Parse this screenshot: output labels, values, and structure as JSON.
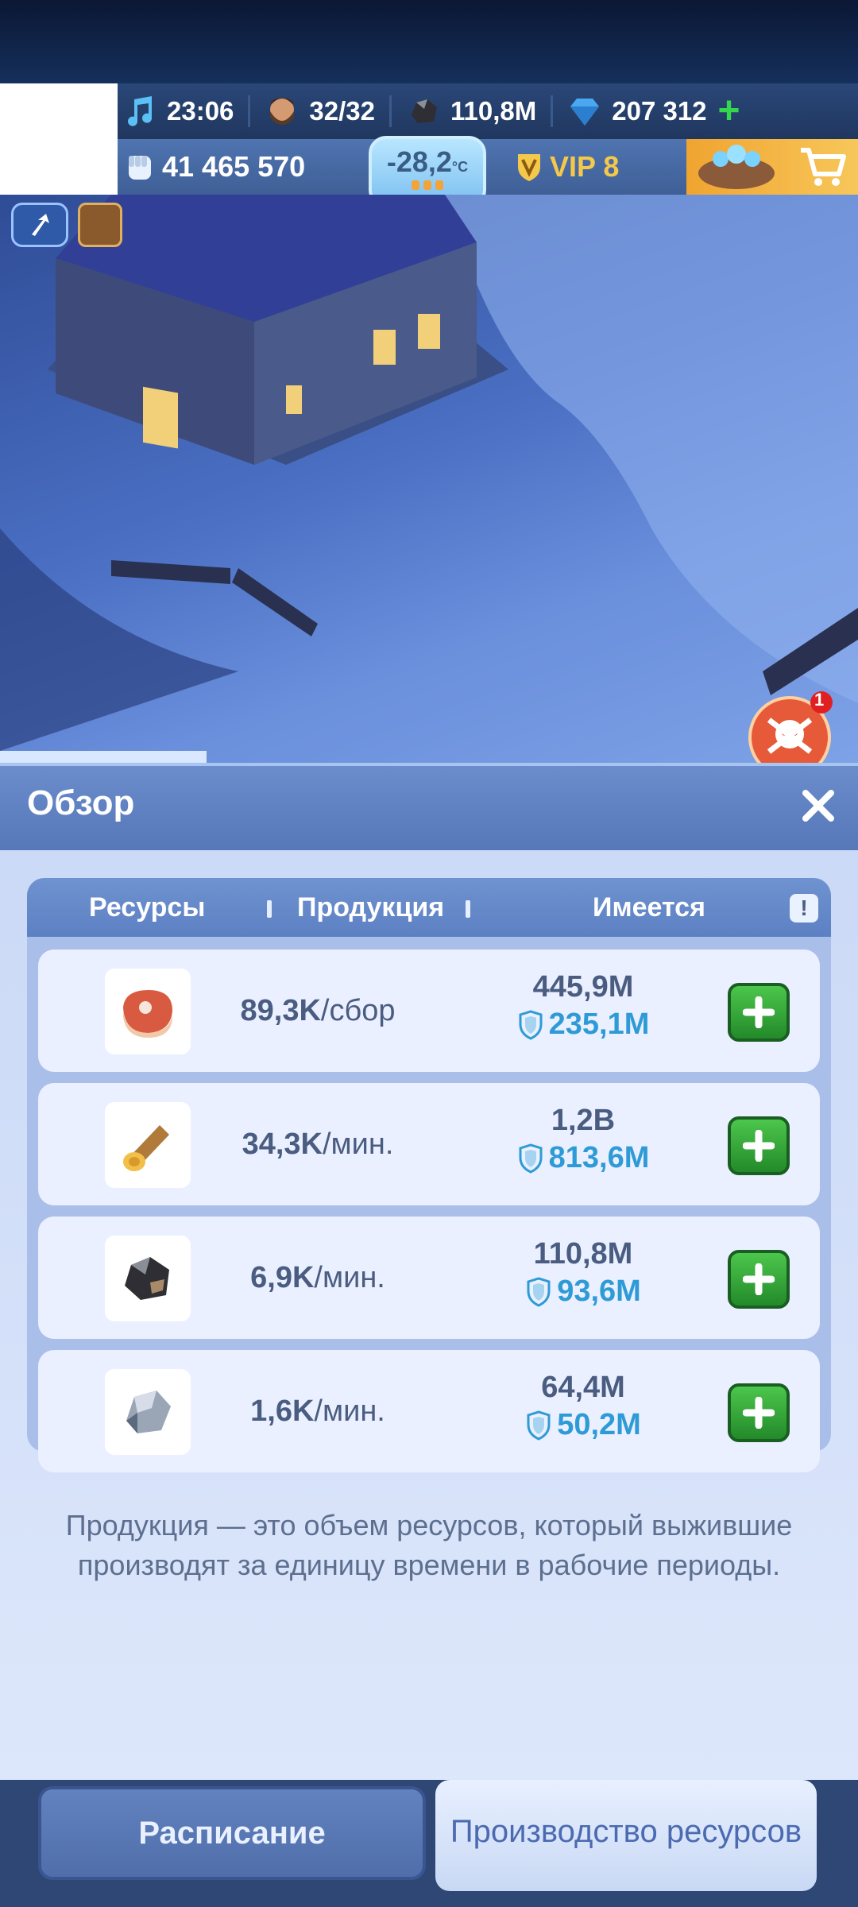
{
  "header": {
    "time": "23:06",
    "survivors": "32/32",
    "coal_top": "110,8M",
    "gems": "207 312",
    "power": "41 465 570",
    "temperature": "-28,2",
    "temperature_unit": "°C",
    "vip": "VIP 8"
  },
  "alert_badge": "1",
  "panel": {
    "title": "Обзор",
    "columns": [
      "Ресурсы",
      "Продукция",
      "Имеется"
    ],
    "rows": [
      {
        "icon": "meat-icon",
        "rate_value": "89,3K",
        "rate_unit": "/сбор",
        "total": "445,9M",
        "protected": "235,1M"
      },
      {
        "icon": "wood-log-icon",
        "rate_value": "34,3K",
        "rate_unit": "/мин.",
        "total": "1,2B",
        "protected": "813,6M"
      },
      {
        "icon": "coal-icon",
        "rate_value": "6,9K",
        "rate_unit": "/мин.",
        "total": "110,8M",
        "protected": "93,6M"
      },
      {
        "icon": "iron-ore-icon",
        "rate_value": "1,6K",
        "rate_unit": "/мин.",
        "total": "64,4M",
        "protected": "50,2M"
      }
    ],
    "description": "Продукция — это объем ресурсов, который выжившие производят за единицу времени в рабочие периоды."
  },
  "tabs": {
    "schedule": "Расписание",
    "production": "Производство ресурсов"
  },
  "colors": {
    "accent_green": "#33d64c",
    "protected_blue": "#2f9bd6",
    "panel_header": "#5677b8"
  }
}
